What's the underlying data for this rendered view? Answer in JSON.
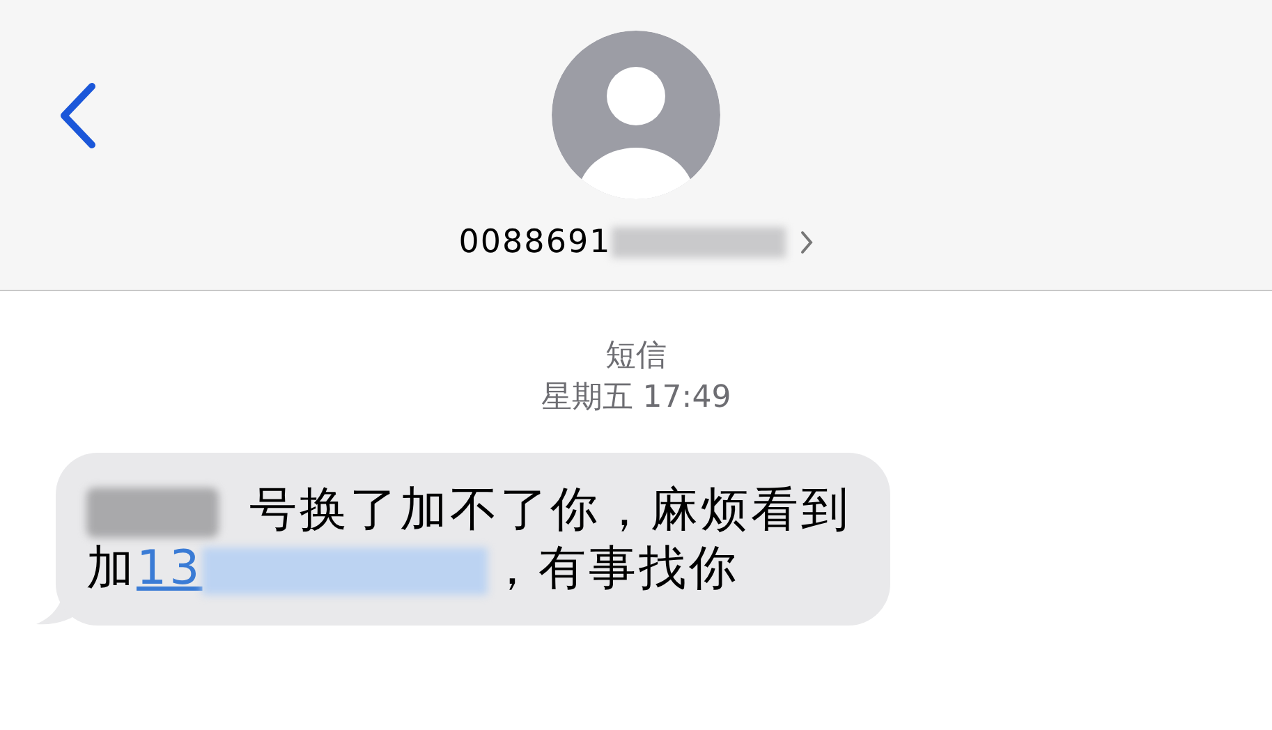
{
  "header": {
    "contact": "0088691"
  },
  "conversation": {
    "service": "短信",
    "timestamp": "星期五 17:49",
    "message_lines": [
      [
        {
          "kind": "redacted"
        },
        {
          "kind": "text",
          "text": "号换了加不了你，麻烦看到"
        }
      ],
      [
        {
          "kind": "text",
          "text": "加"
        },
        {
          "kind": "link",
          "text": "13"
        },
        {
          "kind": "redacted"
        },
        {
          "kind": "text",
          "text": "，有事找你"
        }
      ]
    ]
  }
}
